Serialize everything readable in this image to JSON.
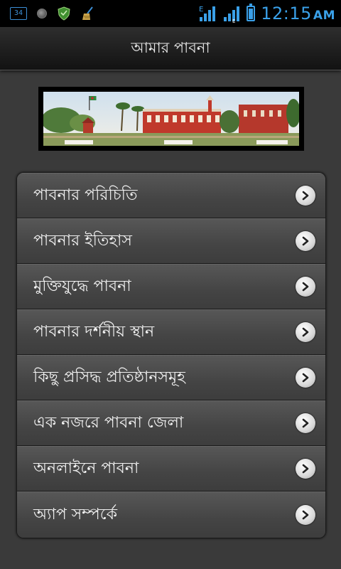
{
  "status_bar": {
    "notification_count": "34",
    "network_label_1": "E",
    "network_label_2": "E",
    "battery_level": 0.85,
    "time": "12:15",
    "ampm": "AM",
    "icons": [
      "notification-count-icon",
      "record-icon",
      "shield-icon",
      "broom-icon",
      "signal-icon",
      "signal-icon",
      "battery-icon"
    ]
  },
  "header": {
    "title": "আমার পাবনা"
  },
  "banner": {
    "icon": "building-photo"
  },
  "menu": {
    "items": [
      {
        "label": "পাবনার পরিচিতি"
      },
      {
        "label": "পাবনার ইতিহাস"
      },
      {
        "label": "মুক্তিযুদ্ধে পাবনা"
      },
      {
        "label": "পাবনার দর্শনীয় স্থান"
      },
      {
        "label": "কিছু প্রসিদ্ধ প্রতিষ্ঠানসমূহ"
      },
      {
        "label": "এক নজরে পাবনা জেলা"
      },
      {
        "label": "অনলাইনে পাবনা"
      },
      {
        "label": "অ্যাপ সম্পর্কে"
      }
    ]
  },
  "colors": {
    "status_accent": "#3aa0e8",
    "background": "#3a3a3a",
    "menu_text": "#f2f2f2"
  }
}
